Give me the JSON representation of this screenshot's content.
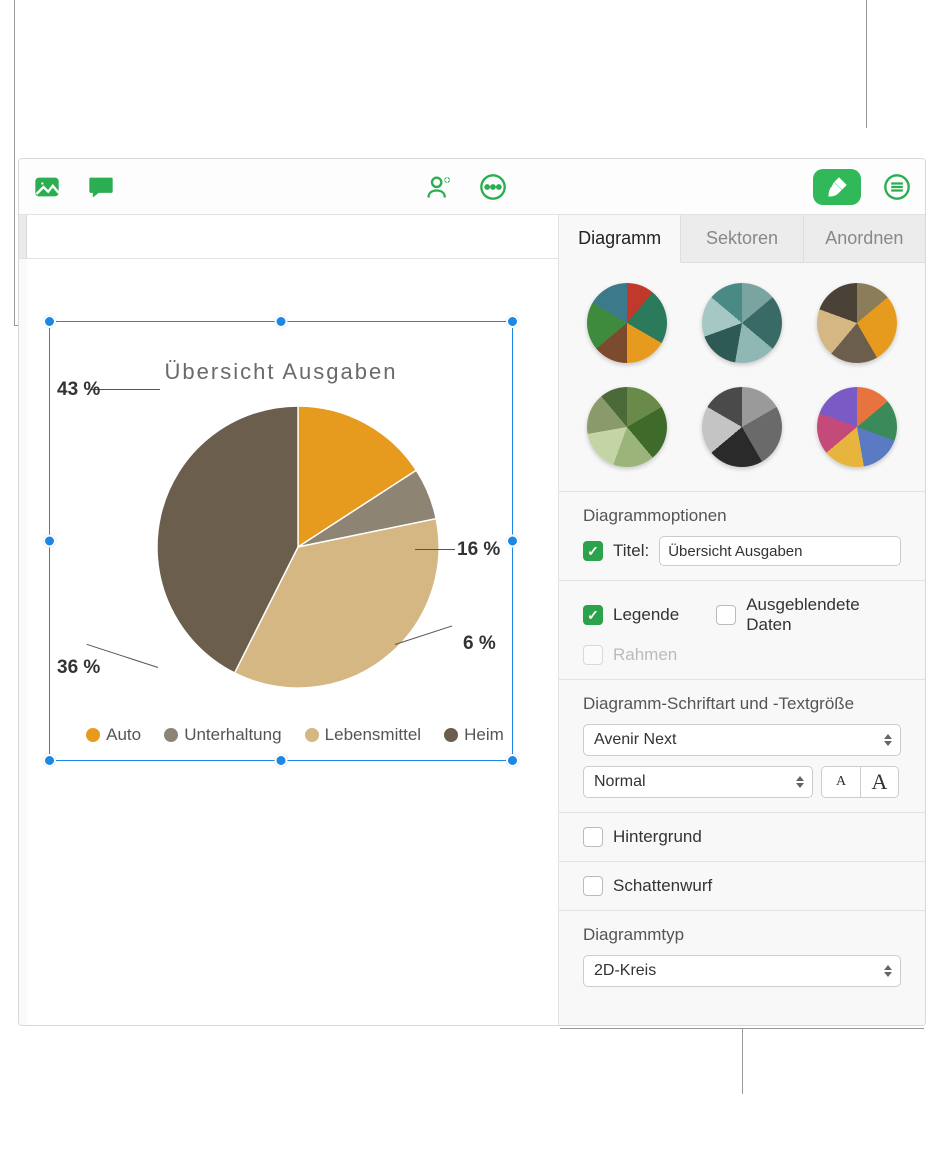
{
  "chart_data": {
    "type": "pie",
    "title": "Übersicht Ausgaben",
    "slices": [
      {
        "label": "Auto",
        "value": 16,
        "color": "#e79b1e"
      },
      {
        "label": "Unterhaltung",
        "value": 6,
        "color": "#8e8474"
      },
      {
        "label": "Lebensmittel",
        "value": 36,
        "color": "#d4b782"
      },
      {
        "label": "Heim",
        "value": 43,
        "color": "#6c5e4d"
      }
    ]
  },
  "toolbar": {
    "icons": {
      "media": "media-icon",
      "comment": "comment-icon",
      "collaborate": "collaborate-icon",
      "more": "more-icon",
      "format": "format-brush-icon",
      "outline": "outline-icon"
    }
  },
  "inspector": {
    "tabs": {
      "chart": "Diagramm",
      "sectors": "Sektoren",
      "arrange": "Anordnen"
    },
    "options": {
      "heading": "Diagrammoptionen",
      "title_label": "Titel:",
      "title_value": "Übersicht Ausgaben",
      "legend_label": "Legende",
      "hidden_data_label": "Ausgeblendete Daten",
      "border_label": "Rahmen"
    },
    "font": {
      "heading": "Diagramm-Schriftart und -Textgröße",
      "family": "Avenir Next",
      "weight": "Normal"
    },
    "background_label": "Hintergrund",
    "shadow_label": "Schattenwurf",
    "type": {
      "heading": "Diagrammtyp",
      "value": "2D-Kreis"
    }
  }
}
